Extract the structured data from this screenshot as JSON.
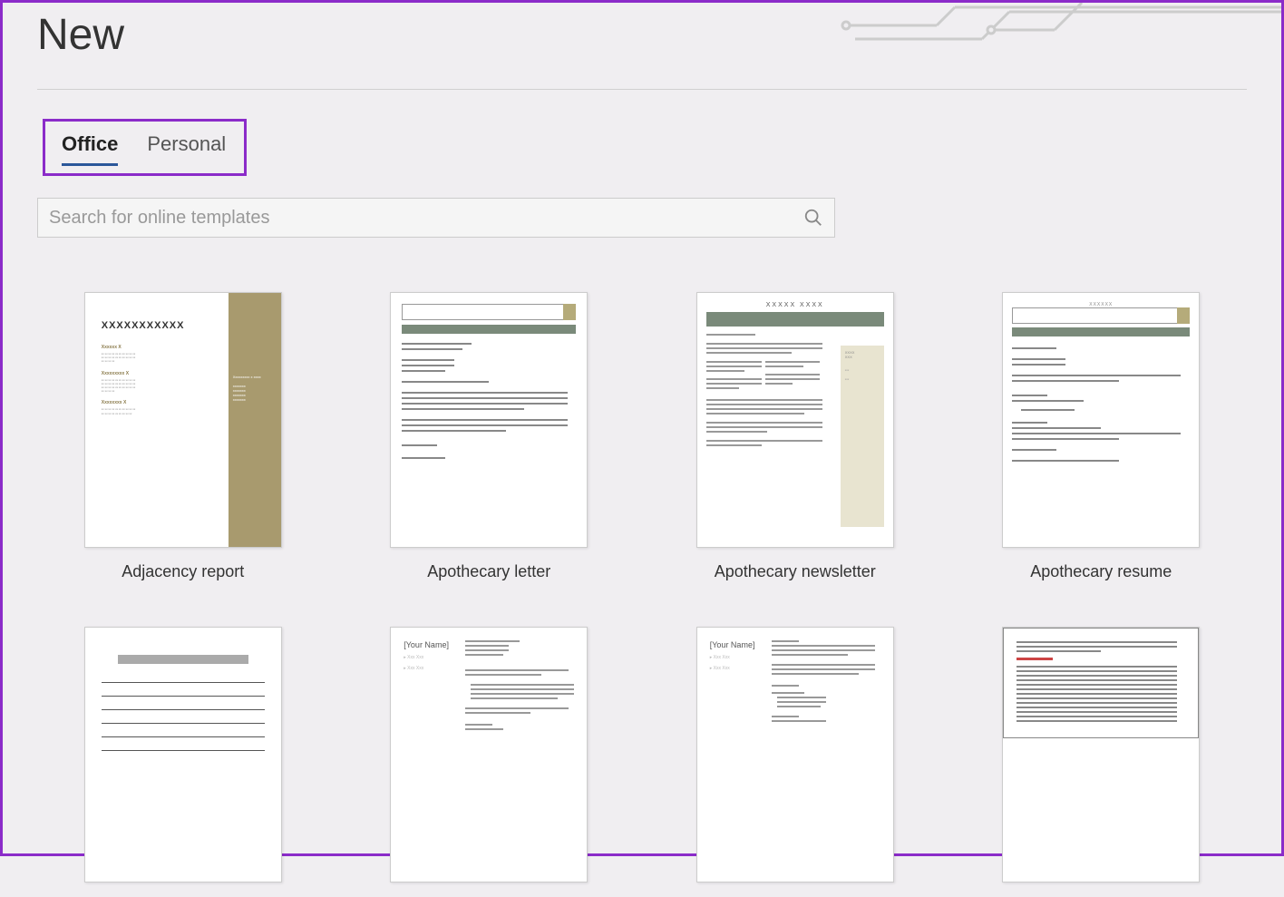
{
  "page": {
    "title": "New"
  },
  "tabs": [
    {
      "label": "Office",
      "active": true
    },
    {
      "label": "Personal",
      "active": false
    }
  ],
  "search": {
    "placeholder": "Search for online templates"
  },
  "templates": [
    {
      "label": "Adjacency report"
    },
    {
      "label": "Apothecary letter"
    },
    {
      "label": "Apothecary newsletter"
    },
    {
      "label": "Apothecary resume"
    },
    {
      "label": ""
    },
    {
      "label": ""
    },
    {
      "label": ""
    },
    {
      "label": ""
    }
  ],
  "thumb": {
    "adj_title": "XXXXXXXXXXX",
    "news_title": "XXXXX XXXX",
    "yourname": "[Your Name]"
  }
}
